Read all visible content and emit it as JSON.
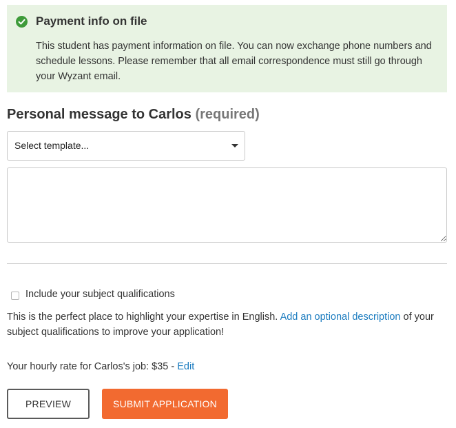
{
  "alert": {
    "icon": "check-circle-icon",
    "icon_color": "#3e9b3a",
    "title": "Payment info on file",
    "body": "This student has payment information on file. You can now exchange phone numbers and schedule lessons. Please remember that all email correspondence must still go through your Wyzant email.",
    "background": "#e8f3e3"
  },
  "message": {
    "heading": "Personal message to Carlos",
    "required": "(required)",
    "template_select_value": "Select template...",
    "textarea_value": ""
  },
  "qualifications": {
    "checkbox_label": "Include your subject qualifications",
    "checked": false,
    "desc_before": "This is the perfect place to highlight your expertise in English.",
    "desc_link": "Add an optional description",
    "desc_after": "of your subject qualifications to improve your application!"
  },
  "rate": {
    "text": "Your hourly rate for Carlos's job: $35 -",
    "edit_label": "Edit"
  },
  "buttons": {
    "preview": "PREVIEW",
    "submit": "SUBMIT APPLICATION",
    "submit_color": "#f26a30"
  },
  "colors": {
    "link": "#1a7bbf",
    "text": "#333333"
  }
}
